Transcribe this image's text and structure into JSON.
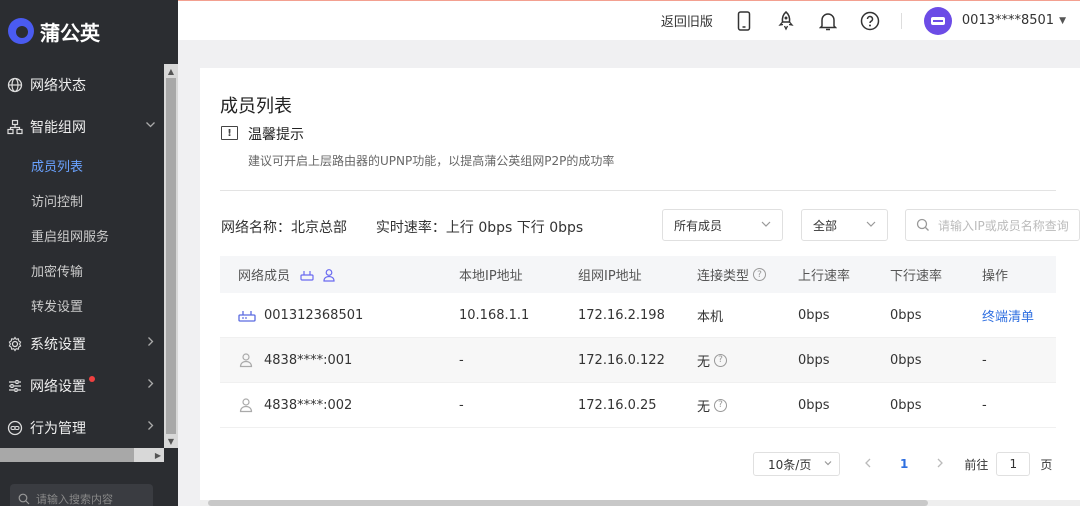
{
  "app": {
    "logo_text": "蒲公英"
  },
  "sidebar": {
    "items": [
      {
        "label": "网络状态",
        "icon": "globe-icon"
      },
      {
        "label": "智能组网",
        "icon": "network-icon",
        "expanded": true
      },
      {
        "label": "系统设置",
        "icon": "gear-icon"
      },
      {
        "label": "网络设置",
        "icon": "sliders-icon",
        "has_dot": true
      },
      {
        "label": "行为管理",
        "icon": "link-icon"
      }
    ],
    "sub_items": [
      "成员列表",
      "访问控制",
      "重启组网服务",
      "加密传输",
      "转发设置"
    ],
    "search_placeholder": "请输入搜索内容"
  },
  "header": {
    "old_version": "返回旧版",
    "user": "0013****8501"
  },
  "page": {
    "title": "成员列表",
    "tip_title": "温馨提示",
    "tip_text": "建议可开启上层路由器的UPNP功能，以提高蒲公英组网P2P的成功率",
    "network_name_label": "网络名称：",
    "network_name": "北京总部",
    "speed_label": "实时速率：",
    "speed_value": "上行 0bps 下行 0bps",
    "filter_member": "所有成员",
    "filter_all": "全部",
    "search_placeholder": "请输入IP或成员名称查询"
  },
  "table": {
    "headers": [
      "网络成员",
      "本地IP地址",
      "组网IP地址",
      "连接类型",
      "上行速率",
      "下行速率",
      "操作"
    ],
    "rows": [
      {
        "member": "001312368501",
        "icon": "router-icon",
        "local_ip": "10.168.1.1",
        "net_ip": "172.16.2.198",
        "conn": "本机",
        "up": "0bps",
        "down": "0bps",
        "action": "终端清单"
      },
      {
        "member": "4838****:001",
        "icon": "user-icon",
        "local_ip": "-",
        "net_ip": "172.16.0.122",
        "conn": "无",
        "up": "0bps",
        "down": "0bps",
        "action": "-"
      },
      {
        "member": "4838****:002",
        "icon": "user-icon",
        "local_ip": "-",
        "net_ip": "172.16.0.25",
        "conn": "无",
        "up": "0bps",
        "down": "0bps",
        "action": "-"
      }
    ]
  },
  "pager": {
    "page_size": "10条/页",
    "current": "1",
    "goto_label": "前往",
    "goto_value": "1",
    "page_suffix": "页"
  },
  "colors": {
    "accent": "#2f6fe0",
    "sidebar_bg": "#2b2d31",
    "brand": "#4a5bf0"
  }
}
